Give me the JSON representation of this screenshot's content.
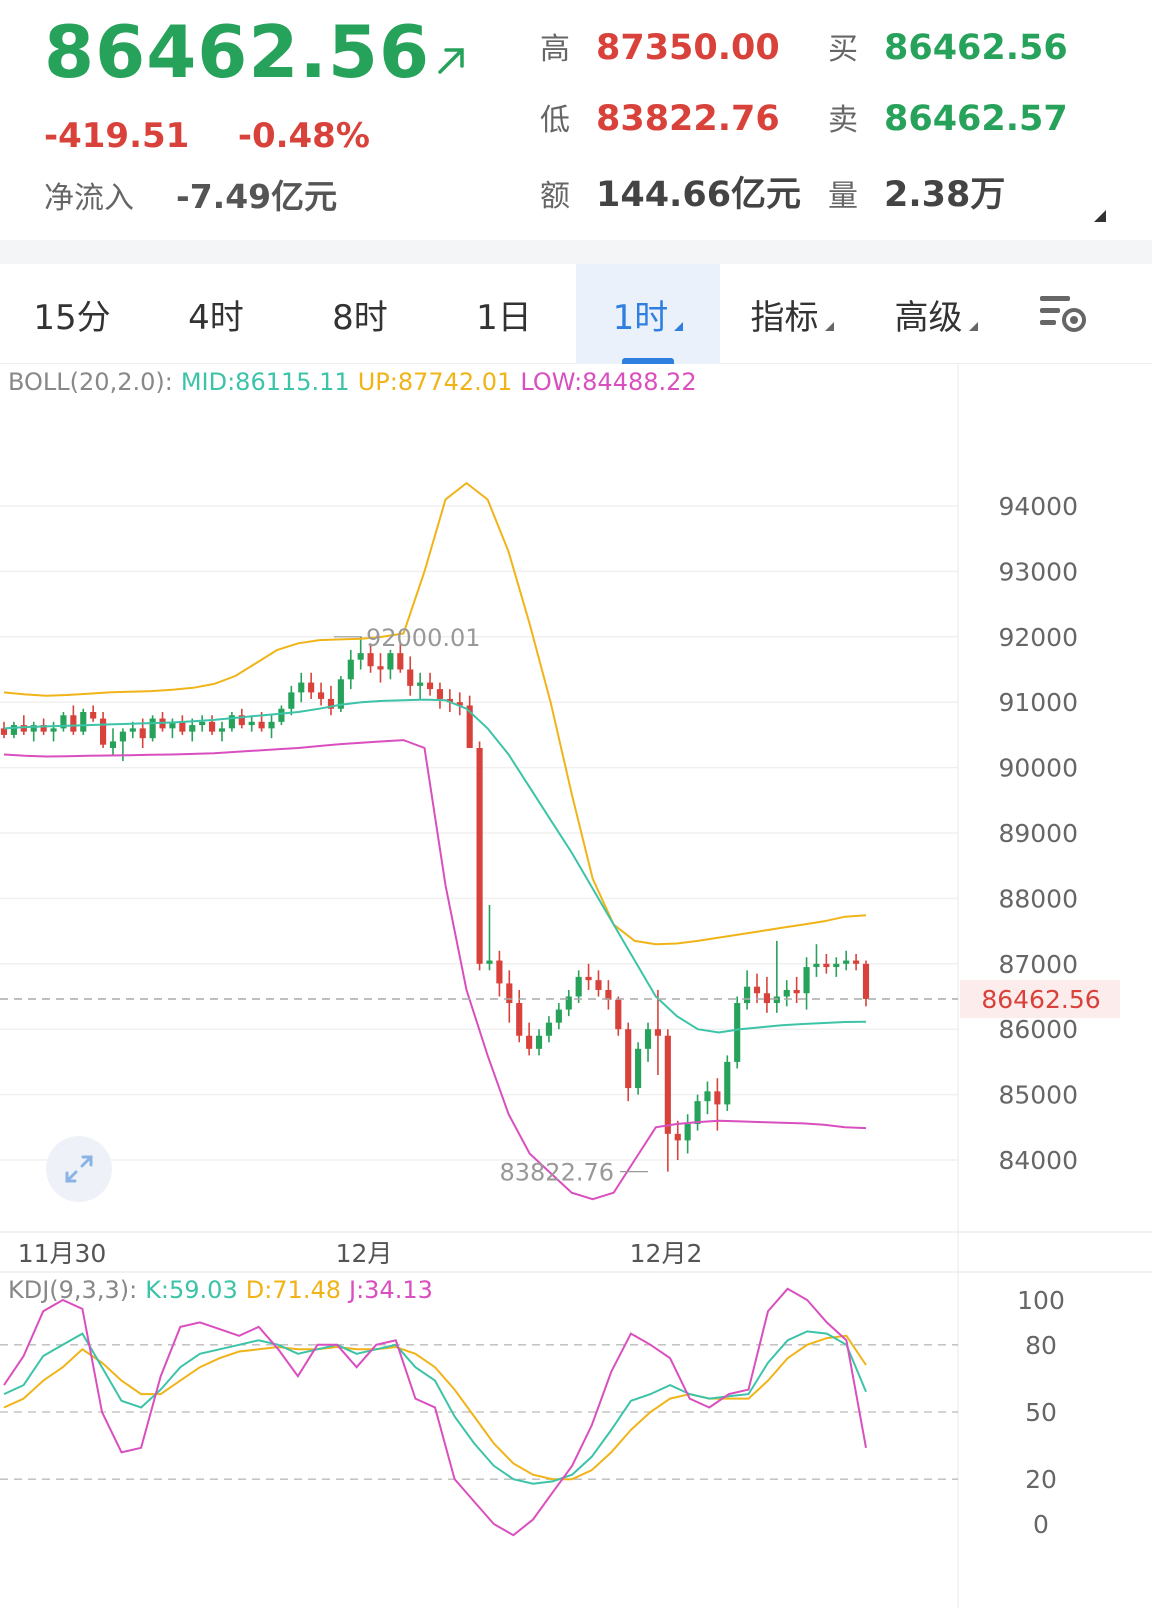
{
  "quote": {
    "price": "86462.56",
    "change_abs": "-419.51",
    "change_pct": "-0.48%",
    "net_inflow_label": "净流入",
    "net_inflow_value": "-7.49亿元",
    "high_label": "高",
    "high_value": "87350.00",
    "low_label": "低",
    "low_value": "83822.76",
    "amount_label": "额",
    "amount_value": "144.66亿元",
    "bid_label": "买",
    "bid_value": "86462.56",
    "ask_label": "卖",
    "ask_value": "86462.57",
    "volume_label": "量",
    "volume_value": "2.38万"
  },
  "tabs": [
    {
      "label": "15分",
      "active": false,
      "dropdown": false
    },
    {
      "label": "4时",
      "active": false,
      "dropdown": false
    },
    {
      "label": "8时",
      "active": false,
      "dropdown": false
    },
    {
      "label": "1日",
      "active": false,
      "dropdown": false
    },
    {
      "label": "1时",
      "active": true,
      "dropdown": true
    },
    {
      "label": "指标",
      "active": false,
      "dropdown": true
    },
    {
      "label": "高级",
      "active": false,
      "dropdown": true
    }
  ],
  "icons": {
    "arrow": "arrow-up-right-icon",
    "settings": "chart-settings-icon",
    "expand": "expand-icon"
  },
  "colors": {
    "up": "#27a25a",
    "down": "#d8423b",
    "mid": "#3cc3a8",
    "upper": "#f0b419",
    "lower": "#d94fbf",
    "active_tab": "#2f7fe0"
  },
  "chart_data": [
    {
      "type": "candlestick",
      "indicator": {
        "name": "BOLL(20,2.0):",
        "mid_label": "MID:86115.11",
        "up_label": "UP:87742.01",
        "low_label": "LOW:84488.22"
      },
      "y_ticks": [
        "94000",
        "93000",
        "92000",
        "91000",
        "90000",
        "89000",
        "88000",
        "87000",
        "86000",
        "85000",
        "84000"
      ],
      "ylim": [
        83200,
        94700
      ],
      "x_labels": [
        "11月30",
        "12月",
        "12月2"
      ],
      "last_price_label": "86462.56",
      "last_price": 86462.56,
      "high_marker": "92000.01",
      "low_marker": "83822.76",
      "candles": [
        [
          90600,
          90700,
          90450,
          90500
        ],
        [
          90500,
          90700,
          90450,
          90650
        ],
        [
          90650,
          90800,
          90500,
          90550
        ],
        [
          90550,
          90700,
          90400,
          90650
        ],
        [
          90650,
          90750,
          90500,
          90550
        ],
        [
          90550,
          90700,
          90400,
          90600
        ],
        [
          90600,
          90850,
          90550,
          90800
        ],
        [
          90800,
          90950,
          90500,
          90550
        ],
        [
          90550,
          90900,
          90500,
          90850
        ],
        [
          90850,
          90950,
          90700,
          90750
        ],
        [
          90750,
          90850,
          90300,
          90350
        ],
        [
          90300,
          90600,
          90200,
          90400
        ],
        [
          90400,
          90600,
          90100,
          90550
        ],
        [
          90550,
          90700,
          90450,
          90600
        ],
        [
          90600,
          90750,
          90300,
          90450
        ],
        [
          90450,
          90800,
          90400,
          90750
        ],
        [
          90750,
          90850,
          90550,
          90600
        ],
        [
          90600,
          90750,
          90450,
          90700
        ],
        [
          90700,
          90800,
          90500,
          90550
        ],
        [
          90550,
          90750,
          90400,
          90650
        ],
        [
          90650,
          90800,
          90550,
          90700
        ],
        [
          90700,
          90800,
          90500,
          90550
        ],
        [
          90550,
          90700,
          90400,
          90600
        ],
        [
          90600,
          90850,
          90550,
          90800
        ],
        [
          90800,
          90900,
          90600,
          90650
        ],
        [
          90650,
          90800,
          90550,
          90700
        ],
        [
          90700,
          90850,
          90550,
          90600
        ],
        [
          90600,
          90800,
          90450,
          90700
        ],
        [
          90700,
          90950,
          90650,
          90900
        ],
        [
          90900,
          91250,
          90800,
          91150
        ],
        [
          91150,
          91450,
          91000,
          91300
        ],
        [
          91300,
          91450,
          91050,
          91150
        ],
        [
          91150,
          91300,
          90950,
          91050
        ],
        [
          91050,
          91250,
          90800,
          90900
        ],
        [
          90900,
          91400,
          90850,
          91350
        ],
        [
          91350,
          91800,
          91200,
          91650
        ],
        [
          91650,
          92000,
          91500,
          91750
        ],
        [
          91750,
          91900,
          91450,
          91550
        ],
        [
          91550,
          91750,
          91300,
          91500
        ],
        [
          91500,
          91800,
          91350,
          91750
        ],
        [
          91750,
          91900,
          91450,
          91500
        ],
        [
          91500,
          91700,
          91100,
          91250
        ],
        [
          91250,
          91450,
          91050,
          91300
        ],
        [
          91300,
          91450,
          91100,
          91200
        ],
        [
          91200,
          91300,
          90900,
          91050
        ],
        [
          91050,
          91200,
          90850,
          91000
        ],
        [
          91000,
          91150,
          90800,
          90950
        ],
        [
          90950,
          91100,
          90500,
          90300
        ],
        [
          90300,
          90400,
          86900,
          87000
        ],
        [
          87000,
          87900,
          86900,
          87050
        ],
        [
          87050,
          87200,
          86500,
          86700
        ],
        [
          86700,
          86900,
          86100,
          86400
        ],
        [
          86400,
          86600,
          85800,
          85900
        ],
        [
          85900,
          86100,
          85600,
          85700
        ],
        [
          85700,
          86000,
          85600,
          85900
        ],
        [
          85900,
          86200,
          85800,
          86100
        ],
        [
          86100,
          86400,
          86000,
          86300
        ],
        [
          86300,
          86600,
          86200,
          86500
        ],
        [
          86500,
          86900,
          86400,
          86800
        ],
        [
          86800,
          87000,
          86600,
          86750
        ],
        [
          86750,
          86900,
          86500,
          86600
        ],
        [
          86600,
          86750,
          86300,
          86450
        ],
        [
          86450,
          86500,
          85900,
          86000
        ],
        [
          86000,
          86100,
          84900,
          85100
        ],
        [
          85100,
          85800,
          85000,
          85700
        ],
        [
          85700,
          86100,
          85500,
          86000
        ],
        [
          86000,
          86600,
          85300,
          85900
        ],
        [
          85900,
          86000,
          83822,
          84400
        ],
        [
          84400,
          84600,
          84000,
          84300
        ],
        [
          84300,
          84700,
          84100,
          84550
        ],
        [
          84550,
          85000,
          84450,
          84900
        ],
        [
          84900,
          85200,
          84700,
          85050
        ],
        [
          85050,
          85250,
          84450,
          84850
        ],
        [
          84850,
          85600,
          84750,
          85500
        ],
        [
          85500,
          86500,
          85400,
          86400
        ],
        [
          86400,
          86900,
          86300,
          86650
        ],
        [
          86650,
          86850,
          86400,
          86550
        ],
        [
          86550,
          86800,
          86250,
          86400
        ],
        [
          86400,
          87350,
          86250,
          86500
        ],
        [
          86500,
          86750,
          86350,
          86600
        ],
        [
          86600,
          86800,
          86400,
          86550
        ],
        [
          86550,
          87100,
          86300,
          86950
        ],
        [
          86950,
          87300,
          86800,
          87000
        ],
        [
          87000,
          87150,
          86850,
          86950
        ],
        [
          86950,
          87100,
          86800,
          87000
        ],
        [
          87000,
          87200,
          86900,
          87050
        ],
        [
          87050,
          87150,
          86900,
          87000
        ],
        [
          87000,
          87050,
          86350,
          86462.56
        ]
      ],
      "mid": [
        90600,
        90620,
        90630,
        90640,
        90650,
        90660,
        90670,
        90680,
        90690,
        90710,
        90730,
        90760,
        90790,
        90820,
        90850,
        90900,
        90960,
        91000,
        91020,
        91030,
        91040,
        91030,
        90900,
        90600,
        90200,
        89700,
        89200,
        88700,
        88150,
        87600,
        87050,
        86500,
        86200,
        86000,
        85950,
        86000,
        86030,
        86060,
        86080,
        86095,
        86110,
        86115
      ],
      "upper": [
        91150,
        91120,
        91100,
        91110,
        91130,
        91150,
        91160,
        91170,
        91190,
        91220,
        91280,
        91400,
        91600,
        91800,
        91900,
        91950,
        91960,
        91970,
        92000,
        92050,
        93000,
        94100,
        94350,
        94100,
        93300,
        92200,
        91000,
        89600,
        88300,
        87600,
        87350,
        87300,
        87310,
        87350,
        87400,
        87450,
        87500,
        87550,
        87600,
        87650,
        87720,
        87742
      ],
      "lower": [
        90200,
        90180,
        90170,
        90175,
        90180,
        90185,
        90190,
        90195,
        90200,
        90210,
        90220,
        90240,
        90260,
        90280,
        90300,
        90330,
        90360,
        90380,
        90400,
        90420,
        90300,
        88200,
        86600,
        85600,
        84700,
        84100,
        83800,
        83500,
        83400,
        83500,
        84000,
        84500,
        84550,
        84580,
        84600,
        84590,
        84580,
        84570,
        84560,
        84540,
        84500,
        84488
      ]
    },
    {
      "type": "line",
      "indicator": {
        "name": "KDJ(9,3,3):",
        "k_label": "K:59.03",
        "d_label": "D:71.48",
        "j_label": "J:34.13"
      },
      "y_ticks": [
        "100",
        "80",
        "50",
        "20",
        "0"
      ],
      "ylim": [
        0,
        100
      ],
      "K": [
        58,
        62,
        75,
        80,
        85,
        70,
        55,
        52,
        60,
        70,
        76,
        78,
        80,
        82,
        80,
        76,
        78,
        80,
        76,
        78,
        80,
        70,
        64,
        48,
        36,
        26,
        20,
        18,
        19,
        22,
        30,
        42,
        55,
        58,
        62,
        58,
        56,
        57,
        58,
        72,
        82,
        86,
        85,
        80,
        59
      ],
      "D": [
        52,
        56,
        64,
        70,
        78,
        72,
        64,
        58,
        58,
        64,
        70,
        74,
        77,
        78,
        79,
        78,
        78,
        79,
        78,
        78,
        79,
        76,
        70,
        60,
        48,
        36,
        27,
        22,
        20,
        20,
        24,
        32,
        42,
        50,
        56,
        58,
        56,
        56,
        56,
        64,
        74,
        80,
        83,
        84,
        71
      ],
      "J": [
        62,
        75,
        95,
        100,
        96,
        50,
        32,
        34,
        66,
        88,
        90,
        87,
        84,
        88,
        78,
        66,
        80,
        80,
        70,
        80,
        82,
        56,
        52,
        20,
        10,
        0,
        -5,
        2,
        14,
        26,
        44,
        68,
        85,
        80,
        74,
        56,
        52,
        58,
        60,
        95,
        105,
        100,
        90,
        82,
        34
      ]
    }
  ]
}
